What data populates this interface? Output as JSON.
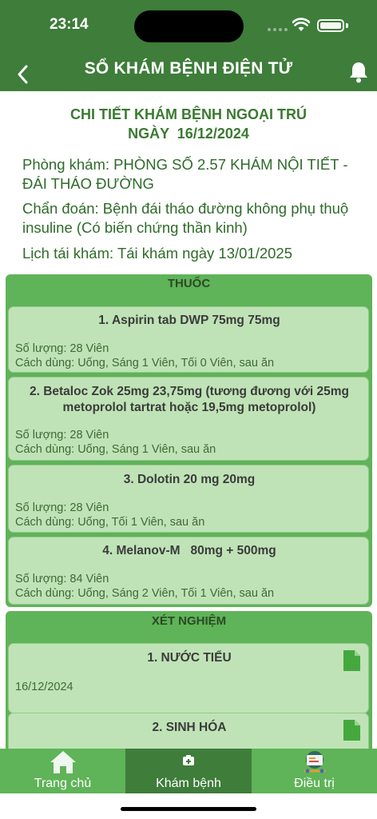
{
  "status": {
    "time": "23:14"
  },
  "header": {
    "title": "SỔ KHÁM BỆNH ĐIỆN TỬ"
  },
  "detail": {
    "title_line1": "CHI TIẾT KHÁM BỆNH NGOẠI TRÚ",
    "title_line2": "NGÀY  16/12/2024",
    "clinic_line1": "Phòng khám: PHÒNG SỐ 2.57 KHÁM NỘI TIẾT -",
    "clinic_line2": "ĐÁI THÁO ĐƯỜNG",
    "diagnosis_line1": "Chẩn đoán: Bệnh đái tháo đường không phụ thuộ",
    "diagnosis_line2": "insuline (Có biến chứng thần kinh)",
    "revisit": "Lịch tái khám: Tái khám ngày 13/01/2025"
  },
  "medications": {
    "title": "THUỐC",
    "items": [
      {
        "name": "1. Aspirin tab DWP 75mg 75mg",
        "quantity": "Số lượng: 28 Viên",
        "usage": "Cách dùng: Uống, Sáng 1 Viên, Tối 0 Viên, sau ăn"
      },
      {
        "name": "2. Betaloc Zok 25mg 23,75mg (tương đương với 25mg metoprolol tartrat hoặc 19,5mg metoprolol)",
        "quantity": "Số lượng: 28 Viên",
        "usage": "Cách dùng: Uống, Sáng 1 Viên, sau ăn"
      },
      {
        "name": "3. Dolotin 20 mg 20mg",
        "quantity": "Số lượng: 28 Viên",
        "usage": "Cách dùng: Uống, Tối 1 Viên, sau ăn"
      },
      {
        "name": "4. Melanov-M   80mg + 500mg",
        "quantity": "Số lượng: 84 Viên",
        "usage": "Cách dùng: Uống, Sáng 2 Viên, Tối 1 Viên, sau ăn"
      }
    ]
  },
  "tests": {
    "title": "XÉT NGHIỆM",
    "items": [
      {
        "name": "1. NƯỚC TIỂU",
        "date": "16/12/2024"
      },
      {
        "name": "2. SINH HÓA",
        "date": ""
      }
    ]
  },
  "nav": {
    "items": [
      {
        "label": "Trang chủ",
        "icon": "home-icon"
      },
      {
        "label": "Khám bệnh",
        "icon": "medical-kit-icon"
      },
      {
        "label": "Điều trị",
        "icon": "treatment-icon"
      }
    ],
    "active_index": 1
  },
  "colors": {
    "header": "#3e7d3a",
    "section": "#5fb358",
    "card": "#bfe3b6",
    "title_text": "#3a7a30"
  }
}
